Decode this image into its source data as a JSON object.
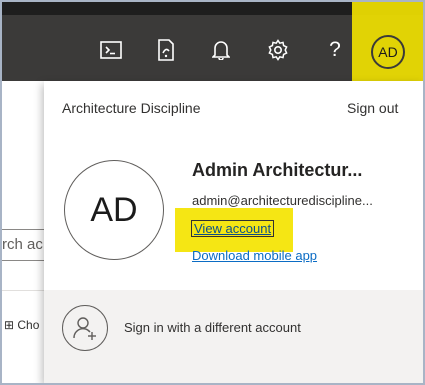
{
  "topbar": {
    "icons": [
      "cloud-shell-icon",
      "feedback-icon",
      "notifications-icon",
      "settings-icon",
      "help-icon"
    ],
    "help_label": "?",
    "avatar_initials": "AD"
  },
  "background": {
    "search_partial": "rch ac",
    "choose_partial": "Cho"
  },
  "account_panel": {
    "org_name": "Architecture Discipline",
    "sign_out_label": "Sign out",
    "avatar_initials": "AD",
    "user_name": "Admin Architectur...",
    "user_email": "admin@architecturediscipline...",
    "view_account_label": "View account",
    "download_app_label": "Download mobile app",
    "switch_account_label": "Sign in with a different account"
  },
  "colors": {
    "topbar": "#3b3a39",
    "highlight": "#f4e400",
    "link": "#0b6cc4",
    "panel_footer": "#f3f2f1"
  }
}
